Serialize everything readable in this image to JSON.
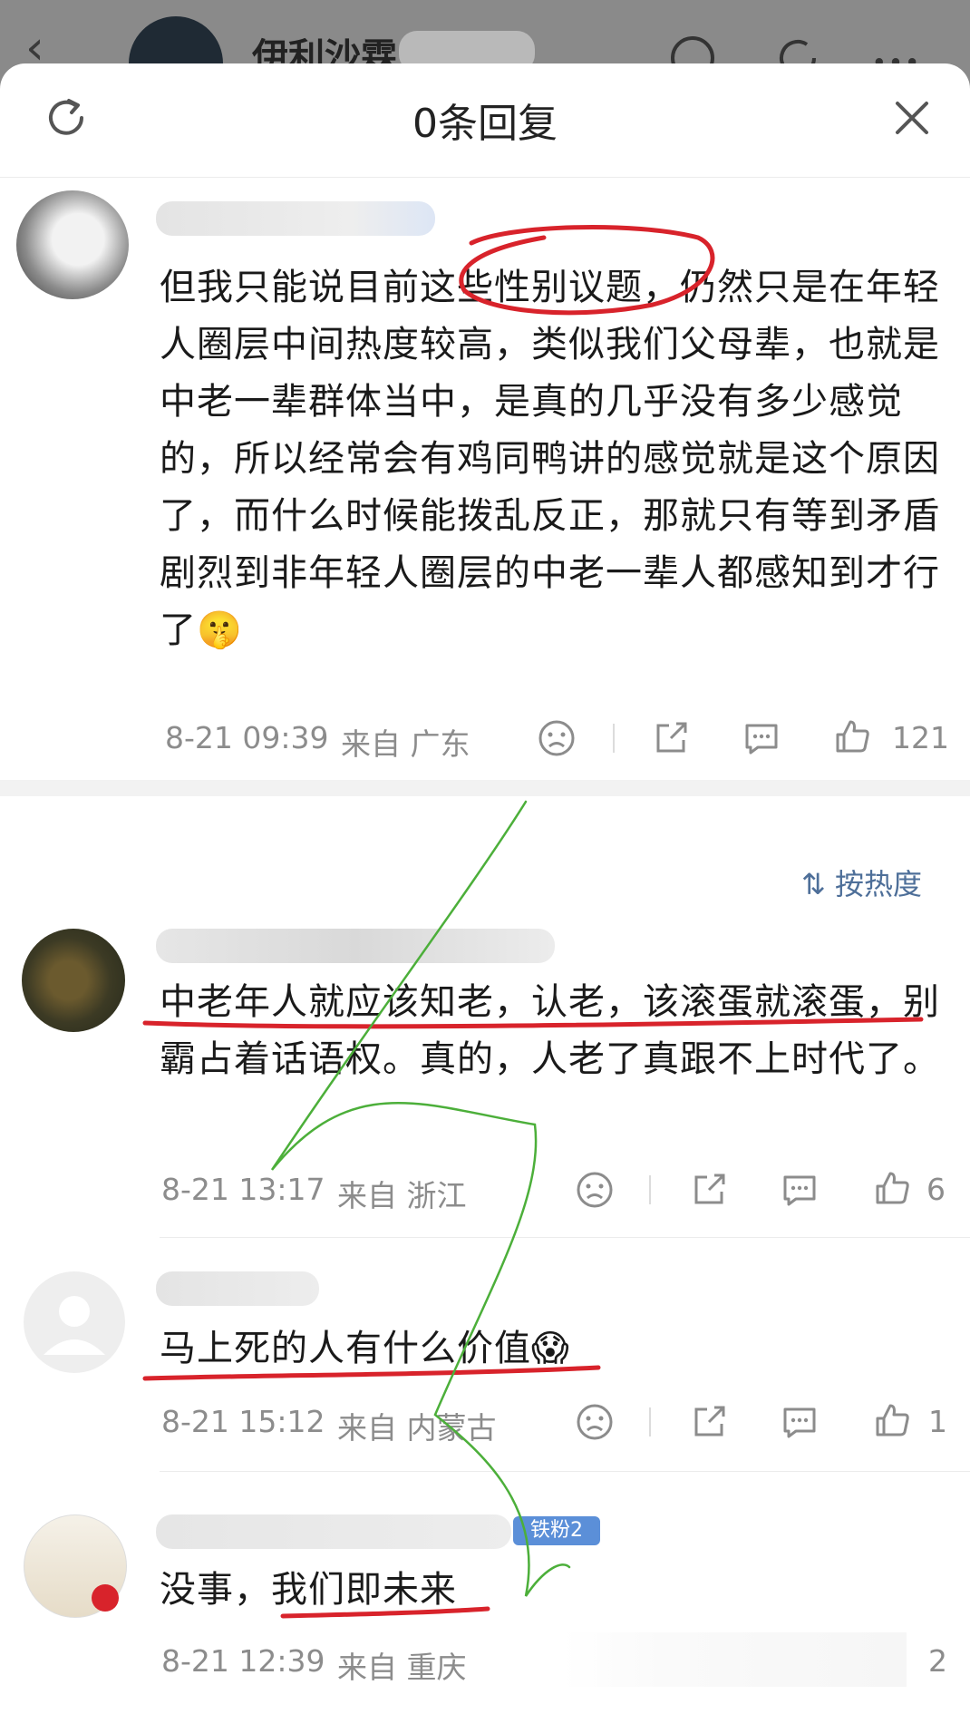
{
  "app_header": {
    "username": "伊利沙霖"
  },
  "sheet": {
    "title": "0条回复"
  },
  "main_comment": {
    "text": "但我只能说目前这些性别议题，仍然只是在年轻人圈层中间热度较高，类似我们父母辈，也就是中老一辈群体当中，是真的几乎没有多少感觉的，所以经常会有鸡同鸭讲的感觉就是这个原因了，而什么时候能拨乱反正，那就只有等到矛盾剧烈到非年轻人圈层的中老一辈人都感知到才行了",
    "emoji": "🤫",
    "time": "8-21 09:39",
    "location": "来自 广东",
    "likes": "121"
  },
  "sort_label": "按热度",
  "replies": [
    {
      "text": "中老年人就应该知老，认老，该滚蛋就滚蛋，别霸占着话语权。真的，人老了真跟不上时代了。",
      "time": "8-21 13:17",
      "location": "来自 浙江",
      "likes": "6"
    },
    {
      "text": "马上死的人有什么价值",
      "emoji": "😱",
      "time": "8-21 15:12",
      "location": "来自 内蒙古",
      "likes": "1"
    },
    {
      "text": "没事，我们即未来",
      "badge": "铁粉2",
      "time": "8-21 12:39",
      "location": "来自 重庆",
      "likes": "2"
    }
  ],
  "colors": {
    "annotation_red": "#d8232b",
    "annotation_green": "#4caf3a",
    "link_blue": "#4e6f99"
  }
}
